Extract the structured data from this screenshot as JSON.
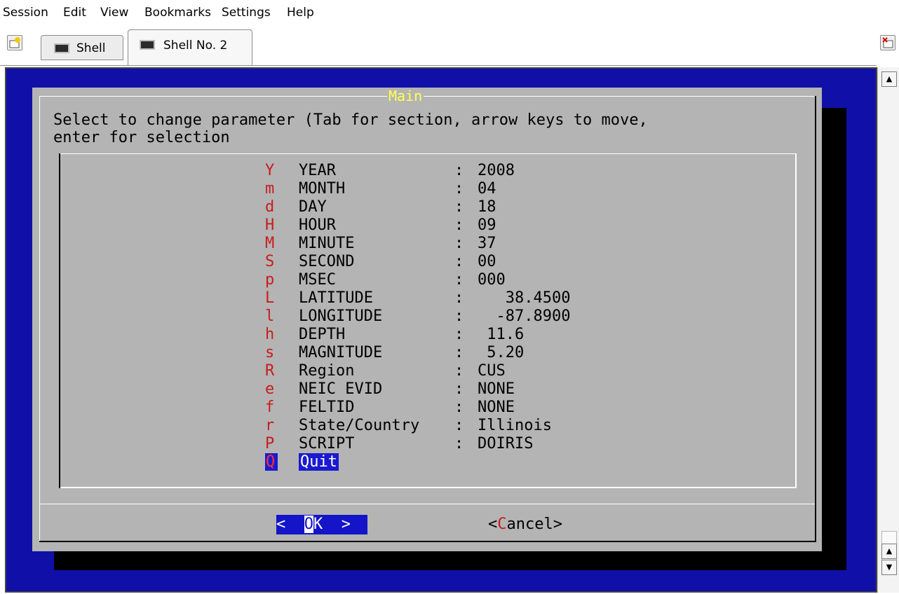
{
  "menubar": {
    "items": [
      "Session",
      "Edit",
      "View",
      "Bookmarks",
      "Settings",
      "Help"
    ]
  },
  "tabs": [
    {
      "label": "Shell",
      "icon": "terminal-icon"
    },
    {
      "label": "Shell No. 2",
      "icon": "terminal-icon"
    }
  ],
  "dialog": {
    "title": "Main",
    "prompt_line1": "Select to change parameter (Tab for section, arrow keys to move,",
    "prompt_line2": "enter for selection",
    "items": [
      {
        "key": "Y",
        "name": "YEAR",
        "value": "2008"
      },
      {
        "key": "m",
        "name": "MONTH",
        "value": "04"
      },
      {
        "key": "d",
        "name": "DAY",
        "value": "18"
      },
      {
        "key": "H",
        "name": "HOUR",
        "value": "09"
      },
      {
        "key": "M",
        "name": "MINUTE",
        "value": "37"
      },
      {
        "key": "S",
        "name": "SECOND",
        "value": "00"
      },
      {
        "key": "p",
        "name": "MSEC",
        "value": "000"
      },
      {
        "key": "L",
        "name": "LATITUDE",
        "value": "   38.4500"
      },
      {
        "key": "l",
        "name": "LONGITUDE",
        "value": "  -87.8900"
      },
      {
        "key": "h",
        "name": "DEPTH",
        "value": " 11.6"
      },
      {
        "key": "s",
        "name": "MAGNITUDE",
        "value": " 5.20"
      },
      {
        "key": "R",
        "name": "Region",
        "value": "CUS"
      },
      {
        "key": "e",
        "name": "NEIC EVID",
        "value": "NONE"
      },
      {
        "key": "f",
        "name": "FELTID",
        "value": "NONE"
      },
      {
        "key": "r",
        "name": "State/Country",
        "value": "Illinois"
      },
      {
        "key": "P",
        "name": "SCRIPT",
        "value": "DOIRIS"
      },
      {
        "key": "Q",
        "name": "Quit",
        "value": ""
      }
    ],
    "ok": {
      "left": "<  ",
      "hot": "O",
      "rest": "K  >"
    },
    "cancel": {
      "left": "<",
      "hot": "C",
      "rest": "ancel>"
    }
  },
  "colors": {
    "terminal_bg": "#1010a8",
    "dialog_bg": "#b4b4b4",
    "hotkey": "#c81c1c",
    "title": "#ffff55",
    "selected_bg": "#1a1ad0"
  }
}
